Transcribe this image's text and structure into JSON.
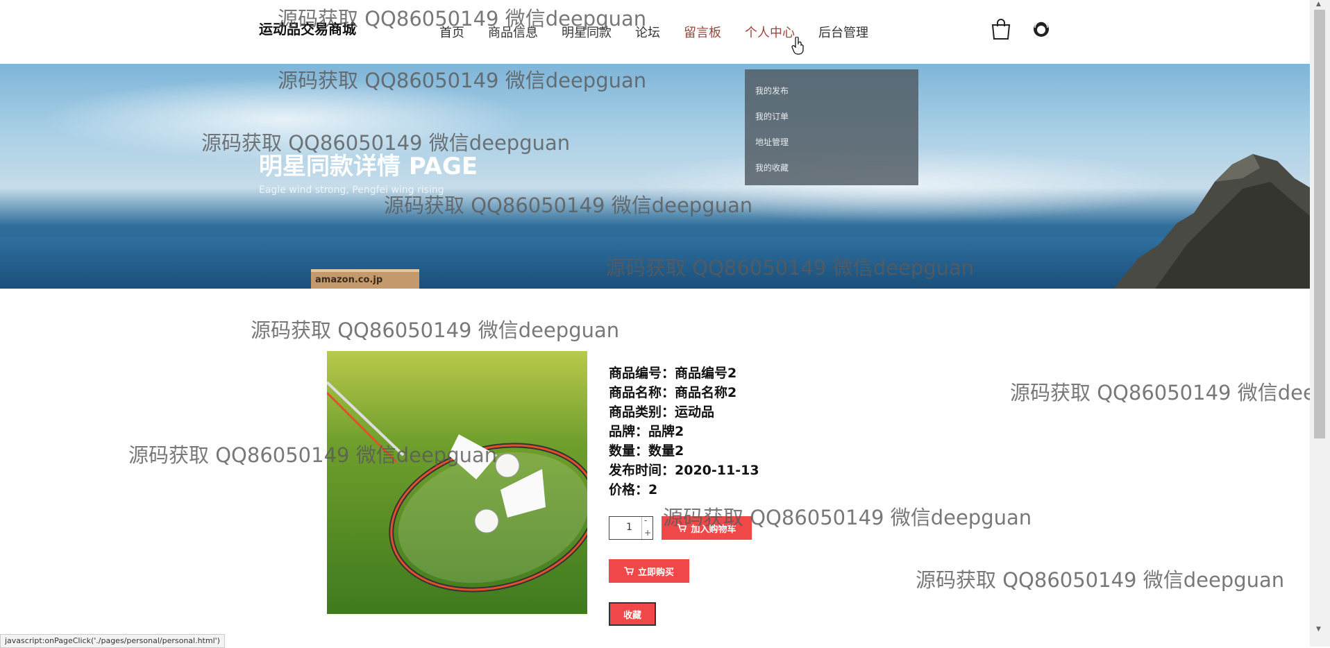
{
  "header": {
    "brand": "运动品交易商城",
    "nav": [
      {
        "label": "首页"
      },
      {
        "label": "商品信息"
      },
      {
        "label": "明星同款"
      },
      {
        "label": "论坛"
      },
      {
        "label": "留言板"
      },
      {
        "label": "个人中心"
      },
      {
        "label": "后台管理"
      }
    ],
    "cart_icon": "shopping-bag-icon",
    "user_icon": "avatar-icon"
  },
  "dropdown": {
    "items": [
      "我的发布",
      "我的订单",
      "地址管理",
      "我的收藏"
    ]
  },
  "banner": {
    "title": "明星同款详情 PAGE",
    "subtitle": "Eagle wind strong, Pengfei wing rising",
    "box_label": "amazon.co.jp"
  },
  "product": {
    "image_alt": "badminton-shuttlecocks-and-racket",
    "fields": [
      {
        "label": "商品编号：",
        "value": "商品编号2"
      },
      {
        "label": "商品名称：",
        "value": "商品名称2"
      },
      {
        "label": "商品类别：",
        "value": "运动品"
      },
      {
        "label": "品牌：",
        "value": "品牌2"
      },
      {
        "label": "数量：",
        "value": "数量2"
      },
      {
        "label": "发布时间：",
        "value": "2020-11-13"
      },
      {
        "label": "价格：",
        "value": "2"
      }
    ],
    "quantity": "1",
    "qty_minus": "-",
    "qty_plus": "+",
    "add_to_cart": "加入购物车",
    "buy_now": "立即购买",
    "favorite": "收藏"
  },
  "watermark": "源码获取 QQ86050149 微信deepguan",
  "status_bar": "javascript:onPageClick('./pages/personal/personal.html')",
  "colors": {
    "accent": "#f04848",
    "nav_active": "#a0443a"
  }
}
